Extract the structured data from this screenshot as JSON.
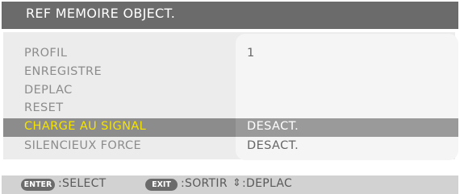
{
  "title": "REF MEMOIRE OBJECT.",
  "items": [
    {
      "label": "PROFIL",
      "value": "1"
    },
    {
      "label": "ENREGISTRE",
      "value": ""
    },
    {
      "label": "DEPLAC",
      "value": ""
    },
    {
      "label": "RESET",
      "value": ""
    },
    {
      "label": "CHARGE AU SIGNAL",
      "value": "DESACT.",
      "selected": true
    },
    {
      "label": "SILENCIEUX FORCE",
      "value": "DESACT."
    }
  ],
  "footer": {
    "enter_key": "ENTER",
    "enter_text": ":SELECT",
    "exit_key": "EXIT",
    "exit_text": ":SORTIR",
    "move_icon": "up-down-arrows-icon",
    "move_text": ":DEPLAC"
  },
  "colors": {
    "title_bg": "#6b6b6b",
    "selected_row_bg": "#8c8c8c",
    "selected_label": "#f5e400",
    "panel_bg": "#ececec"
  }
}
